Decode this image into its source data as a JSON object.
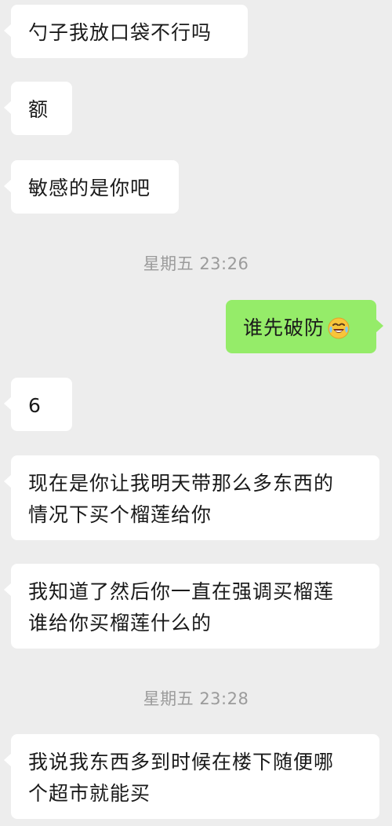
{
  "messages": [
    {
      "type": "in",
      "lines": [
        "勺子我放口袋不行吗"
      ]
    },
    {
      "type": "in",
      "lines": [
        "额"
      ]
    },
    {
      "type": "in",
      "lines": [
        "敏感的是你吧"
      ]
    },
    {
      "type": "time",
      "text": "星期五 23:26"
    },
    {
      "type": "out",
      "text": "谁先破防",
      "emoji": "laughing-crying-emoji"
    },
    {
      "type": "in",
      "lines": [
        "6"
      ]
    },
    {
      "type": "in",
      "lines": [
        "现在是你让我明天带那么多东西的",
        "情况下买个榴莲给你"
      ]
    },
    {
      "type": "in",
      "lines": [
        "我知道了然后你一直在强调买榴莲",
        "谁给你买榴莲什么的"
      ]
    },
    {
      "type": "time",
      "text": "星期五 23:28"
    },
    {
      "type": "in",
      "lines": [
        "我说我东西多到时候在楼下随便哪",
        "个超市就能买"
      ]
    }
  ],
  "colors": {
    "background": "#ededed",
    "incoming_bubble": "#ffffff",
    "outgoing_bubble": "#95ec69",
    "timestamp_text": "#9b9b9b"
  }
}
